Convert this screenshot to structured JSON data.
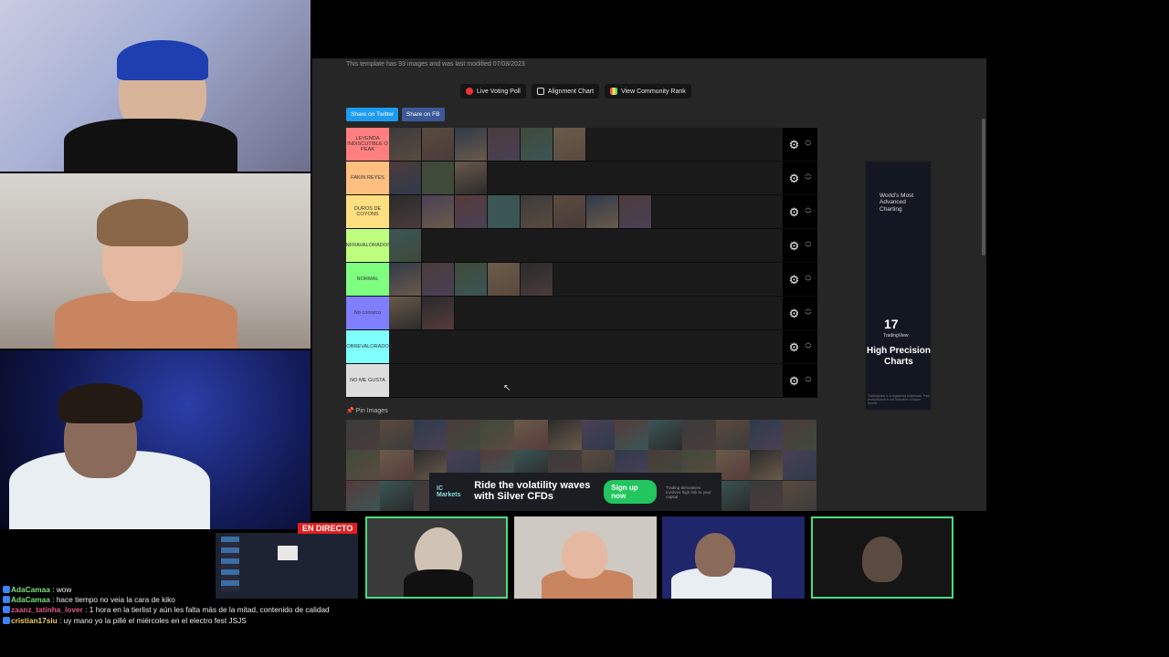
{
  "template_info": "This template has 93 images and was last modified 07/08/2023",
  "buttons": {
    "live_voting": "Live Voting Poll",
    "alignment": "Alignment Chart",
    "community": "View Community Rank",
    "share_twitter": "Share on Twitter",
    "share_fb": "Share on FB"
  },
  "tiers": [
    {
      "label": "LEYENDA INDISCUTIBLE O PEAK",
      "color": "#ff7f7f",
      "count": 6
    },
    {
      "label": "FAKIN REYES",
      "color": "#ffbf7f",
      "count": 3
    },
    {
      "label": "DUROS DE COYONS",
      "color": "#ffdf7f",
      "count": 8
    },
    {
      "label": "INFRAVALORADOS",
      "color": "#bfff7f",
      "count": 1
    },
    {
      "label": "NORMAL",
      "color": "#7fff7f",
      "count": 5
    },
    {
      "label": "No conozco",
      "color": "#7f7fff",
      "count": 2
    },
    {
      "label": "SOBREVALORADOS",
      "color": "#7fffff",
      "count": 0
    },
    {
      "label": "NO ME GUSTA",
      "color": "#dddddd",
      "count": 0
    }
  ],
  "pin_label": "Pin Images",
  "ad_bottom": {
    "brand": "IC Markets",
    "text": "Ride the volatility waves with Silver CFDs",
    "cta": "Sign up now",
    "fine": "Trading derivatives involves high risk to your capital"
  },
  "ad_right": {
    "headline": "World's Most Advanced Charting",
    "logo": "17",
    "brand": "TradingView",
    "tagline": "High Precision Charts",
    "fine": "TradingView is a registered trademark. Past performance is not indicative of future results."
  },
  "live_badge": "EN DIRECTO",
  "chat": [
    {
      "user": "AdaCamaa",
      "color": "#7ee07e",
      "text": "wow"
    },
    {
      "user": "AdaCamaa",
      "color": "#7ee07e",
      "text": "hace tiempo no veia la cara de kiko"
    },
    {
      "user": "zaanz_tatinha_lover",
      "color": "#e05a8a",
      "text": "1 hora en la tierlist y aún les falta más de la mitad, contenido de calidad"
    },
    {
      "user": "cristian17siu",
      "color": "#f0d060",
      "text": "uy mano yo la pillé el miércoles en el electro fest JSJS"
    }
  ],
  "colors": {
    "panel": "#262626",
    "active_call_border": "#4ade80",
    "share_twitter": "#1d9bf0",
    "share_fb": "#3b5998"
  }
}
